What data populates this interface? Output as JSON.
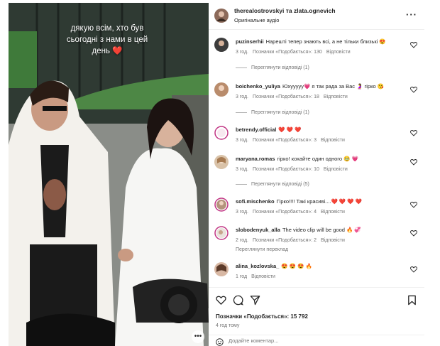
{
  "overlay_text": "дякую всім, хто був\nсьогодні з нами в цей\nдень ❤️",
  "header": {
    "names": "therealostrovskyi та zlata.ognevich",
    "audio": "Оригінальне аудіо",
    "more_icon": "more-horizontal-icon"
  },
  "comments": [
    {
      "user": "puzinserhii",
      "text": "Нарешті тепер знають всі, а не тільки близькі 😍",
      "time": "3 год.",
      "likes": "Позначки «Подобається»: 130",
      "reply": "Відповісти",
      "view_replies": "Переглянути відповіді (1)"
    },
    {
      "user": "boichenko_yuliya",
      "text": "Юхууууу💗 я так рада за Вас 🤰 гірко 😘",
      "time": "3 год.",
      "likes": "Позначки «Подобається»: 18",
      "reply": "Відповісти",
      "view_replies": "Переглянути відповіді (1)"
    },
    {
      "user": "betrendy.official",
      "text": "❤️ ❤️ ❤️",
      "time": "3 год.",
      "likes": "Позначки «Подобається»: 3",
      "reply": "Відповісти"
    },
    {
      "user": "maryana.romas",
      "text": "гірко! кохайте один одного 🥹 💗",
      "time": "3 год.",
      "likes": "Позначки «Подобається»: 10",
      "reply": "Відповісти",
      "view_replies": "Переглянути відповіді (5)"
    },
    {
      "user": "sofi.mischenko",
      "text": "Гірко!!!! Такі красиві....❤️ ❤️ ❤️ ❤️",
      "time": "3 год.",
      "likes": "Позначки «Подобається»: 4",
      "reply": "Відповісти"
    },
    {
      "user": "slobodenyuk_alla",
      "text": "The video clip will be good 🔥 💞",
      "time": "2 год.",
      "likes": "Позначки «Подобається»: 2",
      "reply": "Відповісти",
      "translate": "Переглянути переклад"
    },
    {
      "user": "alina_kozlovska_",
      "text": "😍 😍 😍 🔥",
      "time": "1 год",
      "reply": "Відповісти"
    }
  ],
  "actions": {
    "likes": "Позначки «Подобається»: 15 792",
    "time": "4 год тому",
    "comment_placeholder": "Додайте коментар..."
  },
  "colors": {
    "text": "#262626",
    "secondary": "#737373",
    "divider": "#efefef"
  }
}
